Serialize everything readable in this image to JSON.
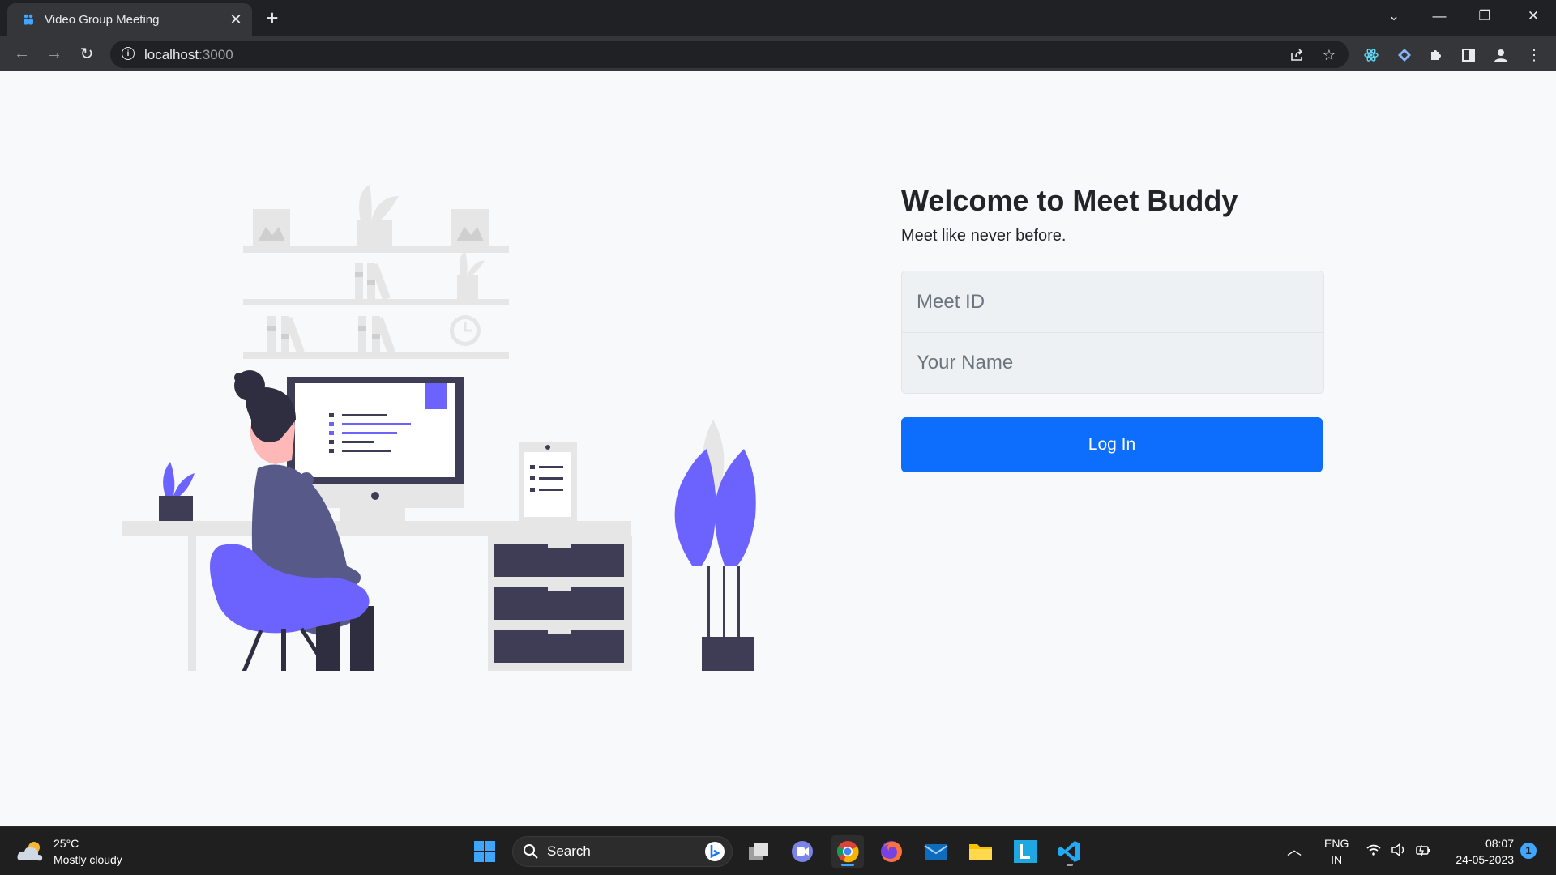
{
  "browser": {
    "tab_title": "Video Group Meeting",
    "tab_close": "✕",
    "new_tab": "+",
    "url_host": "localhost",
    "url_port": ":3000",
    "window_controls": [
      "⌄",
      "—",
      "❐",
      "✕"
    ],
    "nav": {
      "back": "←",
      "forward": "→",
      "reload": "↻"
    }
  },
  "page": {
    "welcome": "Welcome to Meet Buddy",
    "tagline": "Meet like never before.",
    "meet_id_placeholder": "Meet ID",
    "name_placeholder": "Your Name",
    "login_label": "Log In"
  },
  "taskbar": {
    "temperature": "25°C",
    "weather": "Mostly cloudy",
    "search_label": "Search",
    "language_line1": "ENG",
    "language_line2": "IN",
    "time": "08:07",
    "date": "24-05-2023",
    "notification_count": "1"
  },
  "colors": {
    "accent": "#0d6efd",
    "illustration_purple": "#6c63ff",
    "illustration_dark": "#3f3d56"
  }
}
